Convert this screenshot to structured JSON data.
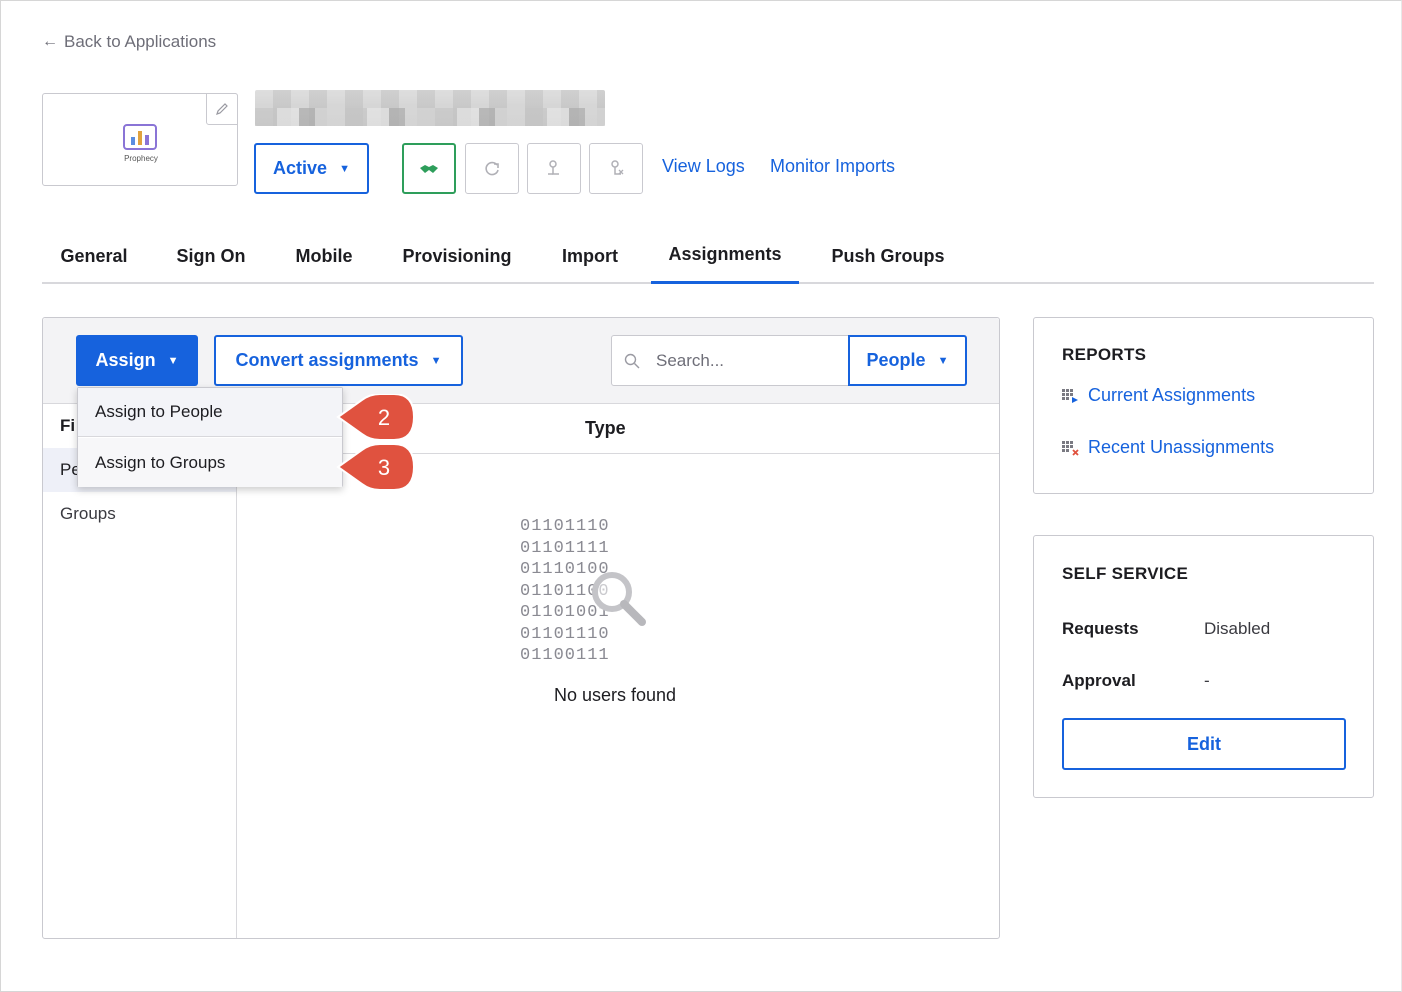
{
  "back_link": {
    "label": "Back to Applications"
  },
  "app": {
    "logo_text": "Prophecy"
  },
  "status": {
    "label": "Active"
  },
  "header_links": {
    "view_logs": "View Logs",
    "monitor_imports": "Monitor Imports"
  },
  "tabs": [
    {
      "label": "General"
    },
    {
      "label": "Sign On"
    },
    {
      "label": "Mobile"
    },
    {
      "label": "Provisioning"
    },
    {
      "label": "Import"
    },
    {
      "label": "Assignments",
      "active": true
    },
    {
      "label": "Push Groups"
    }
  ],
  "toolbar": {
    "assign_label": "Assign",
    "convert_label": "Convert assignments",
    "search_placeholder": "Search...",
    "people_label": "People"
  },
  "assign_menu": [
    {
      "label": "Assign to People"
    },
    {
      "label": "Assign to Groups"
    }
  ],
  "filters": {
    "head": "Fi",
    "people": "Pe",
    "groups": "Groups"
  },
  "table": {
    "type_header": "Type"
  },
  "empty_state": {
    "binary_lines": [
      "01101110",
      "01101111",
      "01110100",
      "01101100",
      "01101001",
      "01101110",
      "01100111"
    ],
    "message": "No users found"
  },
  "callouts": {
    "first": "2",
    "second": "3"
  },
  "reports": {
    "title": "REPORTS",
    "current_assignments": "Current Assignments",
    "recent_unassignments": "Recent Unassignments"
  },
  "self_service": {
    "title": "SELF SERVICE",
    "requests_label": "Requests",
    "requests_value": "Disabled",
    "approval_label": "Approval",
    "approval_value": "-",
    "edit_label": "Edit"
  },
  "colors": {
    "accent": "#1662dd",
    "callout": "#e0523f",
    "success": "#2e9e5b"
  }
}
